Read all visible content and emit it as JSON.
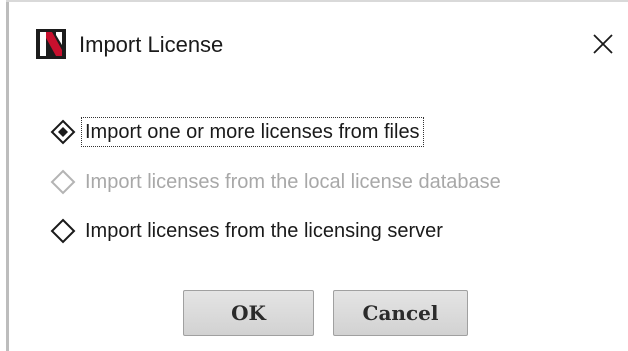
{
  "window": {
    "title": "Import License",
    "logo_letter": "N",
    "close_glyph": "✕",
    "logo_colors": {
      "background": "#1c1c1c",
      "accent": "#c8102e"
    }
  },
  "options": [
    {
      "label": "Import one or more licenses from files",
      "selected": true,
      "enabled": true,
      "focused": true
    },
    {
      "label": "Import licenses from the local license database",
      "selected": false,
      "enabled": false,
      "focused": false
    },
    {
      "label": "Import licenses from the licensing server",
      "selected": false,
      "enabled": true,
      "focused": false
    }
  ],
  "buttons": {
    "ok_label": "OK",
    "cancel_label": "Cancel"
  },
  "icons": {
    "logo": "app-logo-icon",
    "close": "close-icon",
    "radio_selected": "diamond-radio-selected-icon",
    "radio_unselected": "diamond-radio-unselected-icon"
  },
  "colors": {
    "text": "#1a1a1a",
    "disabled_text": "#a8a8a8",
    "button_face": "#dcdcdc"
  }
}
